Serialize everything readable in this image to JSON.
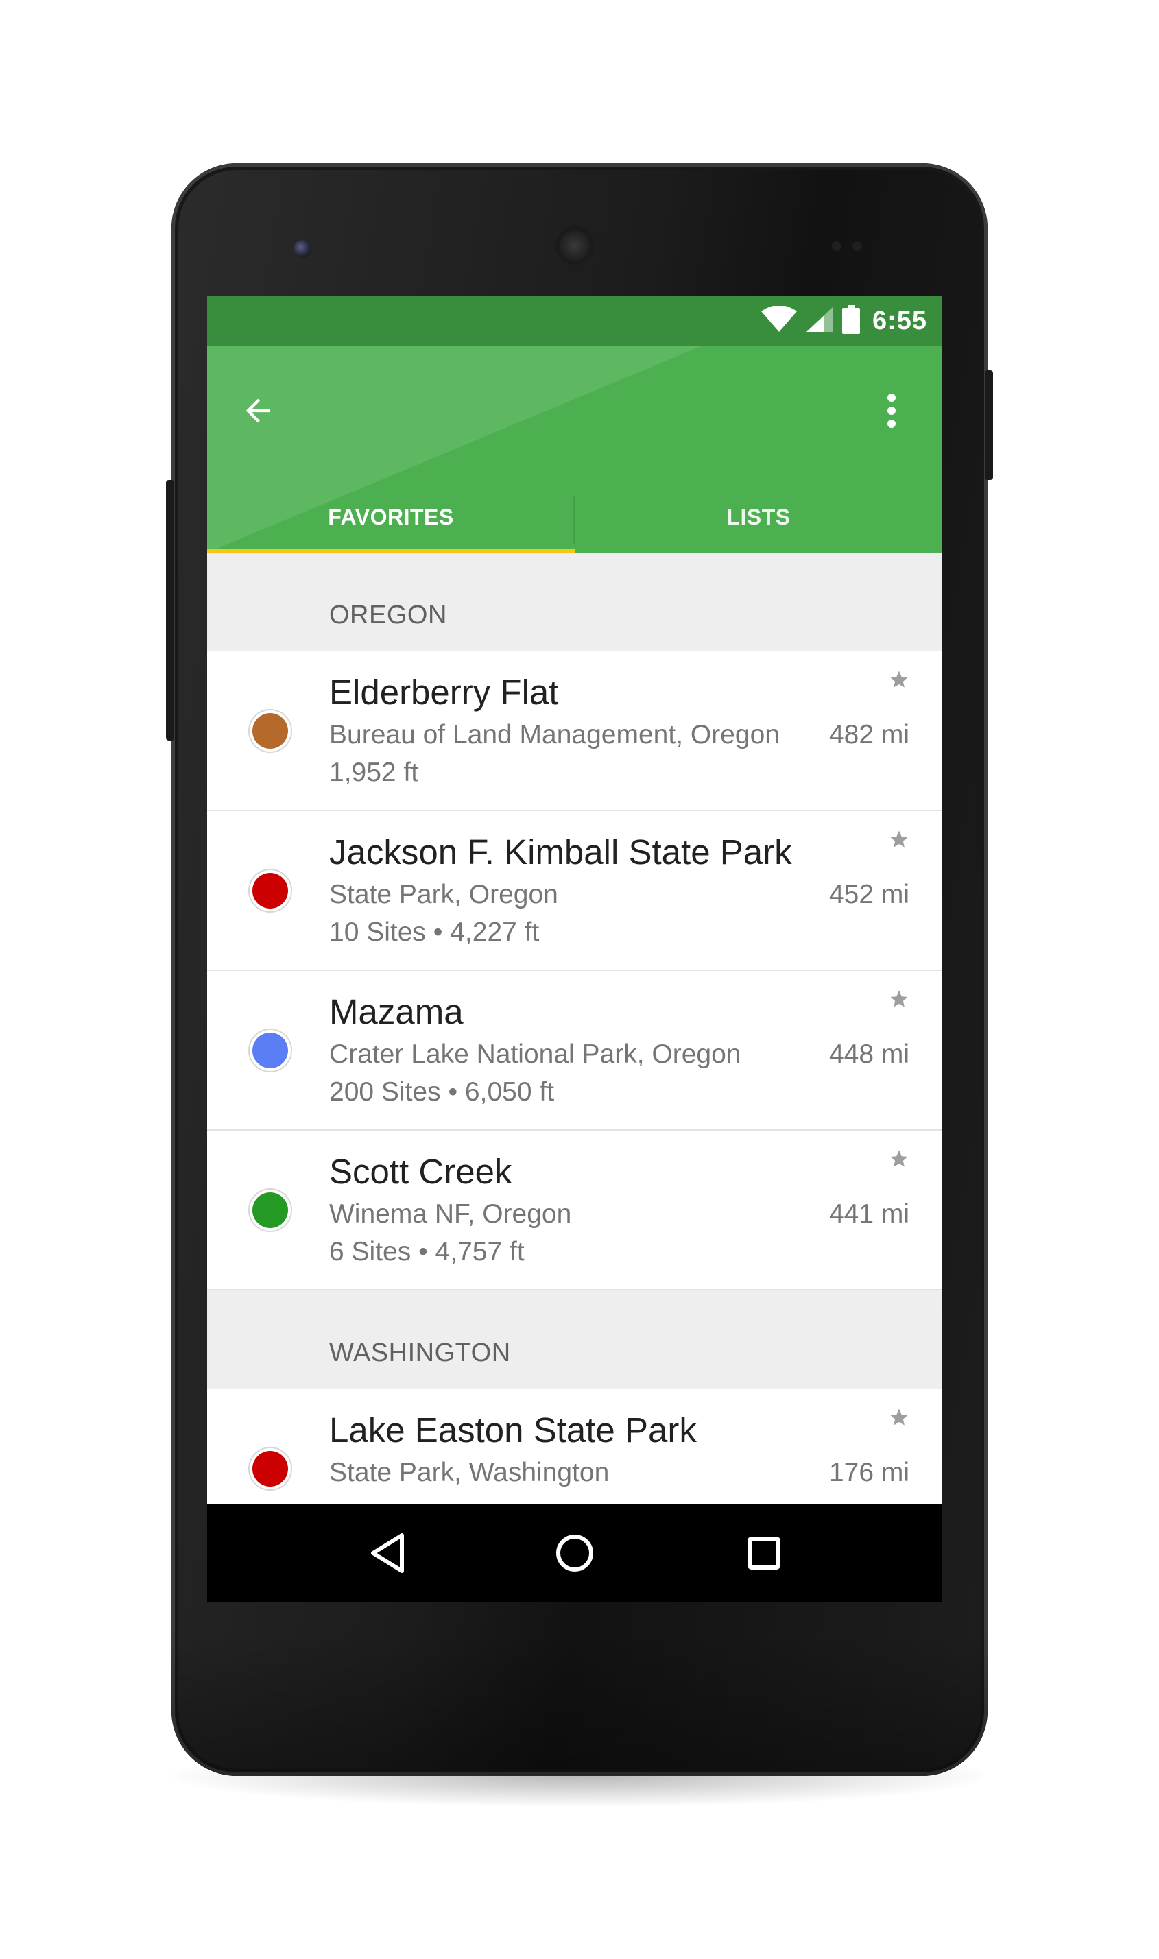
{
  "status_bar": {
    "time": "6:55"
  },
  "app_bar": {
    "back_icon": "arrow-back-icon",
    "menu_icon": "more-vert-icon"
  },
  "tabs": [
    {
      "label": "FAVORITES",
      "selected": true
    },
    {
      "label": "LISTS",
      "selected": false
    }
  ],
  "colors": {
    "primary": "#4caf50",
    "primary_dark": "#388e3c",
    "tab_indicator": "#f5c518"
  },
  "sections": [
    {
      "header": "OREGON",
      "items": [
        {
          "name": "Elderberry Flat",
          "subtitle": "Bureau of Land Management, Oregon",
          "meta": "1,952 ft",
          "distance": "482 mi",
          "color": "#b5692a"
        },
        {
          "name": "Jackson F. Kimball State Park",
          "subtitle": "State Park, Oregon",
          "meta": "10 Sites • 4,227 ft",
          "distance": "452 mi",
          "color": "#cc0000"
        },
        {
          "name": "Mazama",
          "subtitle": "Crater Lake National Park, Oregon",
          "meta": "200 Sites • 6,050 ft",
          "distance": "448 mi",
          "color": "#5b7ef5"
        },
        {
          "name": "Scott Creek",
          "subtitle": "Winema NF, Oregon",
          "meta": "6 Sites • 4,757 ft",
          "distance": "441 mi",
          "color": "#249a24"
        }
      ]
    },
    {
      "header": "WASHINGTON",
      "items": [
        {
          "name": "Lake Easton State Park",
          "subtitle": "State Park, Washington",
          "meta": "",
          "distance": "176 mi",
          "color": "#cc0000"
        }
      ]
    }
  ]
}
